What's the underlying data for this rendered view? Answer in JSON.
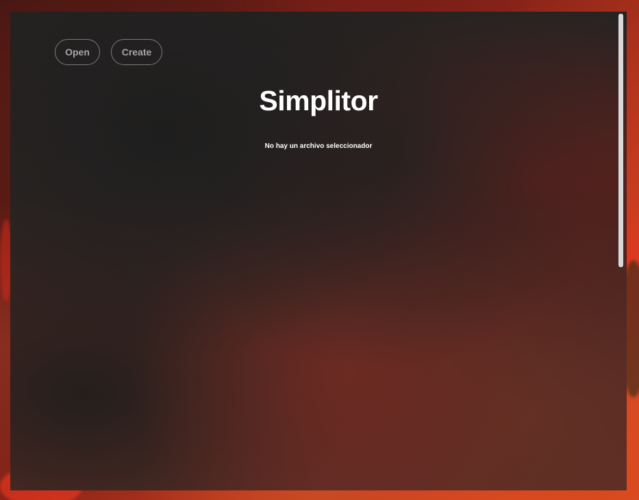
{
  "toolbar": {
    "open_label": "Open",
    "create_label": "Create"
  },
  "main": {
    "title": "Simplitor",
    "status": "No hay un archivo seleccionador"
  },
  "colors": {
    "text": "#ffffff",
    "button_text": "#a6a6a6",
    "button_border": "#c8c8c8",
    "accent_red": "#e8341f"
  }
}
